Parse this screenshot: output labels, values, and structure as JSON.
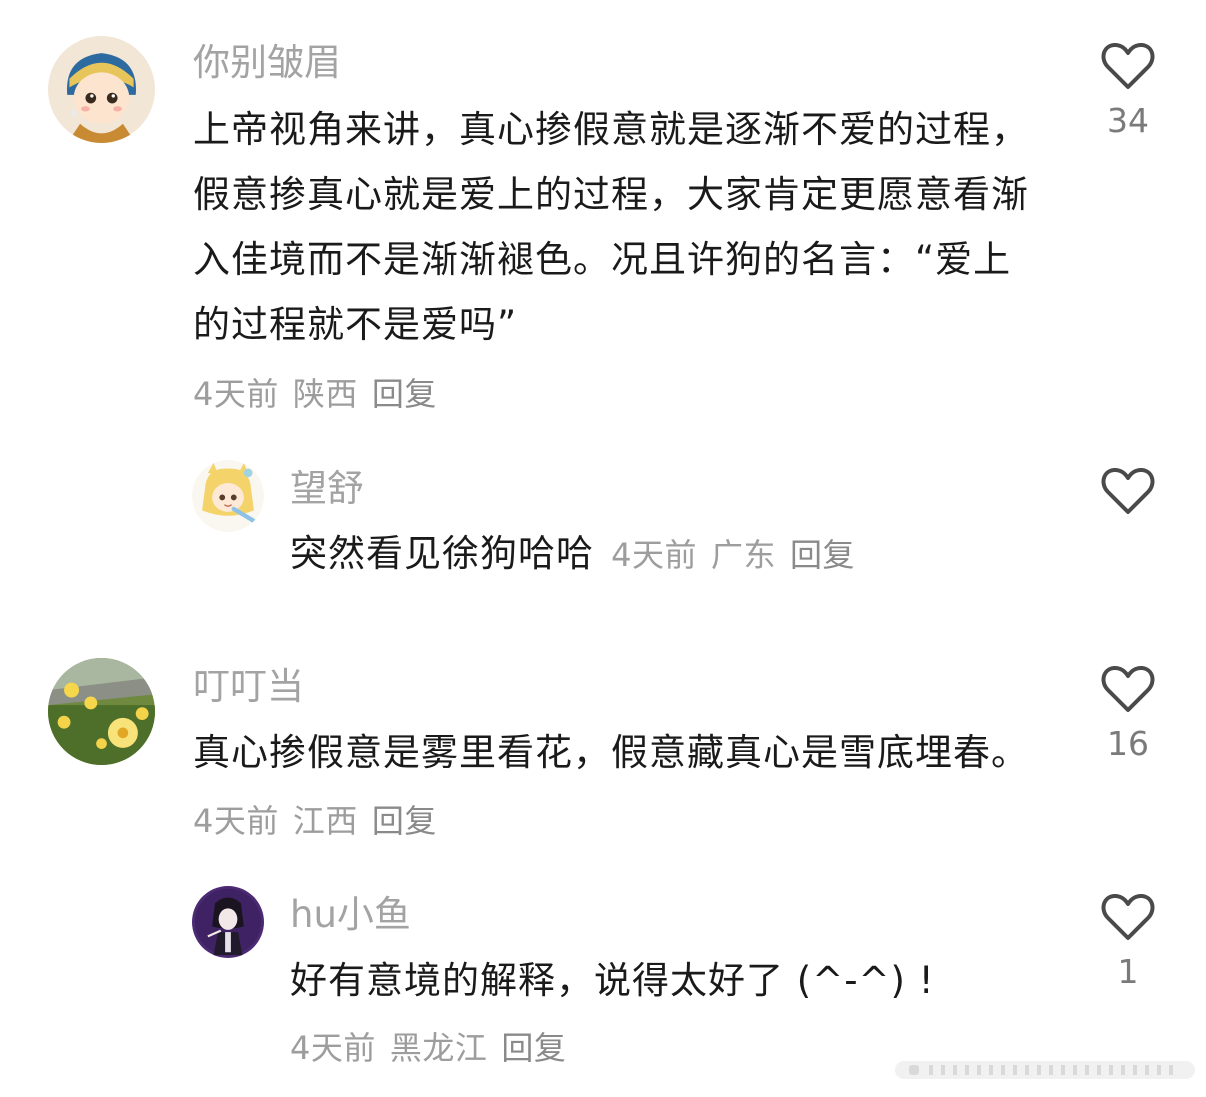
{
  "comments": [
    {
      "username": "你别皱眉",
      "text": "上帝视角来讲，真心掺假意就是逐渐不爱的过程，假意掺真心就是爱上的过程，大家肯定更愿意看渐入佳境而不是渐渐褪色。况且许狗的名言：“爱上的过程就不是爱吗”",
      "time": "4天前",
      "location": "陕西",
      "reply": "回复",
      "likes": "34"
    },
    {
      "username": "望舒",
      "text": "突然看见徐狗哈哈",
      "time": "4天前",
      "location": "广东",
      "reply": "回复",
      "likes": ""
    },
    {
      "username": "叮叮当",
      "text": "真心掺假意是雾里看花，假意藏真心是雪底埋春。",
      "time": "4天前",
      "location": "江西",
      "reply": "回复",
      "likes": "16"
    },
    {
      "username": "hu小鱼",
      "text": "好有意境的解释，说得太好了 (^-^) !",
      "time": "4天前",
      "location": "黑龙江",
      "reply": "回复",
      "likes": "1"
    }
  ],
  "colors": {
    "username": "#a3a3a3",
    "text": "#1a1a1a",
    "meta": "#9d9d9d",
    "like_icon": "#4a4a4a"
  },
  "icons": {
    "like": "heart-outline-icon"
  }
}
